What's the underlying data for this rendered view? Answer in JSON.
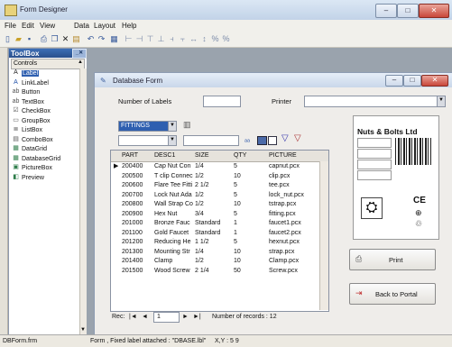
{
  "app": {
    "title": "Form Designer",
    "window_buttons": [
      "–",
      "□",
      "✕"
    ]
  },
  "menu": [
    "File",
    "Edit",
    "View",
    "Data",
    "Layout",
    "Help"
  ],
  "toolbar": {
    "icons": [
      "new-icon",
      "open-icon",
      "save-icon",
      "print-icon",
      "cut-icon",
      "copy-icon",
      "paste-icon",
      "undo-icon",
      "redo-icon",
      "grid-icon",
      "align-left-icon",
      "align-center-icon",
      "align-right-icon",
      "align-top-icon",
      "align-middle-icon",
      "align-bottom-icon",
      "space-icon",
      "size-icon",
      "zoom-in-icon",
      "zoom-out-icon"
    ]
  },
  "toolbox": {
    "title": "ToolBox",
    "tab": "Controls",
    "items": [
      {
        "label": "Label",
        "glyph": "A"
      },
      {
        "label": "LinkLabel",
        "glyph": "A"
      },
      {
        "label": "Button",
        "glyph": "ab"
      },
      {
        "label": "TextBox",
        "glyph": "ab"
      },
      {
        "label": "CheckBox",
        "glyph": "☑"
      },
      {
        "label": "GroupBox",
        "glyph": "▭"
      },
      {
        "label": "ListBox",
        "glyph": "≣"
      },
      {
        "label": "ComboBox",
        "glyph": "▤"
      },
      {
        "label": "DataGrid",
        "glyph": "▦"
      },
      {
        "label": "DatabaseGrid",
        "glyph": "▦"
      },
      {
        "label": "PictureBox",
        "glyph": "▣"
      },
      {
        "label": "Preview",
        "glyph": "◧"
      }
    ]
  },
  "form": {
    "title": "Database Form",
    "number_of_labels_label": "Number of Labels",
    "printer_label": "Printer",
    "table_combo_value": "FITTINGS",
    "grid": {
      "columns": [
        "PART",
        "DESC1",
        "SIZE",
        "QTY",
        "PICTURE"
      ],
      "rows": [
        [
          "200400",
          "Cap Nut Con",
          "1/4",
          "5",
          "capnut.pcx"
        ],
        [
          "200500",
          "T clip Connec",
          "1/2",
          "10",
          "clip.pcx"
        ],
        [
          "200600",
          "Flare Tee Fitti",
          "2 1/2",
          "5",
          "tee.pcx"
        ],
        [
          "200700",
          "Lock Nut Ada",
          "1/2",
          "5",
          "lock_nut.pcx"
        ],
        [
          "200800",
          "Wall Strap Co",
          "1/2",
          "10",
          "tstrap.pcx"
        ],
        [
          "200900",
          "Hex Nut",
          "3/4",
          "5",
          "fitting.pcx"
        ],
        [
          "201000",
          "Bronze Fauc",
          "Standard",
          "1",
          "faucet1.pcx"
        ],
        [
          "201100",
          "Gold Faucet",
          "Standard",
          "1",
          "faucet2.pcx"
        ],
        [
          "201200",
          "Reducing He",
          "1 1/2",
          "5",
          "hexnut.pcx"
        ],
        [
          "201300",
          "Mounting Str",
          "1/4",
          "10",
          "strap.pcx"
        ],
        [
          "201400",
          "Clamp",
          "1/2",
          "10",
          "Clamp.pcx"
        ],
        [
          "201500",
          "Wood Screw",
          "2 1/4",
          "50",
          "Screw.pcx"
        ]
      ]
    },
    "nav": {
      "rec_label": "Rec:",
      "current": "1",
      "records_text": "Number of records : 12"
    },
    "label_card": {
      "company": "Nuts & Bolts Ltd"
    },
    "print_button": "Print",
    "back_button": "Back to Portal"
  },
  "status": {
    "file": "DBForm.frm",
    "info": "Form , Fixed label attached : \"DBASE.lbl\"",
    "coords": "X,Y : 5 9"
  }
}
